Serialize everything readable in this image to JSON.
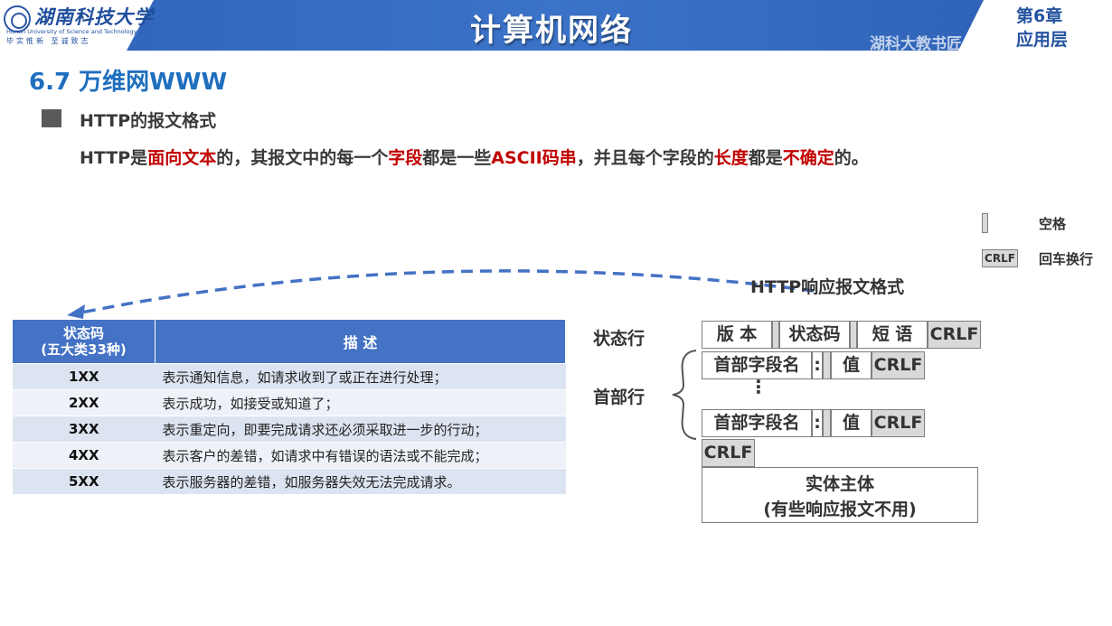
{
  "header": {
    "logo_cn": "湖南科技大学",
    "logo_en": "Hunan University of Science and Technology",
    "logo_motto": "毕实惟新  至诚致志",
    "course_title": "计算机网络",
    "chapter_no": "第6章",
    "chapter_name": "应用层",
    "watermark": "湖科大教书匠",
    "colors": {
      "banner": "#3b6fc2",
      "accent": "#c00000",
      "section": "#1f6fbf"
    }
  },
  "section": {
    "title": "6.7 万维网WWW",
    "bullet": "HTTP的报文格式"
  },
  "paragraph": {
    "p1": "HTTP是",
    "r1": "面向文本",
    "p2": "的，其报文中的每一个",
    "r2": "字段",
    "p3": "都是一些",
    "r3": "ASCII码串",
    "p4": "，并且每个字段的",
    "r4": "长度",
    "p5": "都是",
    "r5": "不确定",
    "p6": "的。"
  },
  "legend": {
    "space_label": "空格",
    "crlf_box": "CRLF",
    "crlf_label": "回车换行"
  },
  "table": {
    "header_code_line1": "状态码",
    "header_code_line2": "(五大类33种)",
    "header_desc": "描 述",
    "rows": [
      {
        "code": "1XX",
        "desc": "表示通知信息，如请求收到了或正在进行处理；"
      },
      {
        "code": "2XX",
        "desc": "表示成功，如接受或知道了；"
      },
      {
        "code": "3XX",
        "desc": "表示重定向，即要完成请求还必须采取进一步的行动；"
      },
      {
        "code": "4XX",
        "desc": "表示客户的差错，如请求中有错误的语法或不能完成；"
      },
      {
        "code": "5XX",
        "desc": "表示服务器的差错，如服务器失效无法完成请求。"
      }
    ]
  },
  "response": {
    "title": "HTTP响应报文格式",
    "status_line_label": "状态行",
    "header_line_label": "首部行",
    "version": "版 本",
    "status_code": "状态码",
    "phrase": "短 语",
    "crlf": "CRLF",
    "header_field": "首部字段名",
    "colon": ":",
    "value": "值",
    "vdots": "⋮",
    "entity_line1": "实体主体",
    "entity_line2": "(有些响应报文不用)"
  }
}
